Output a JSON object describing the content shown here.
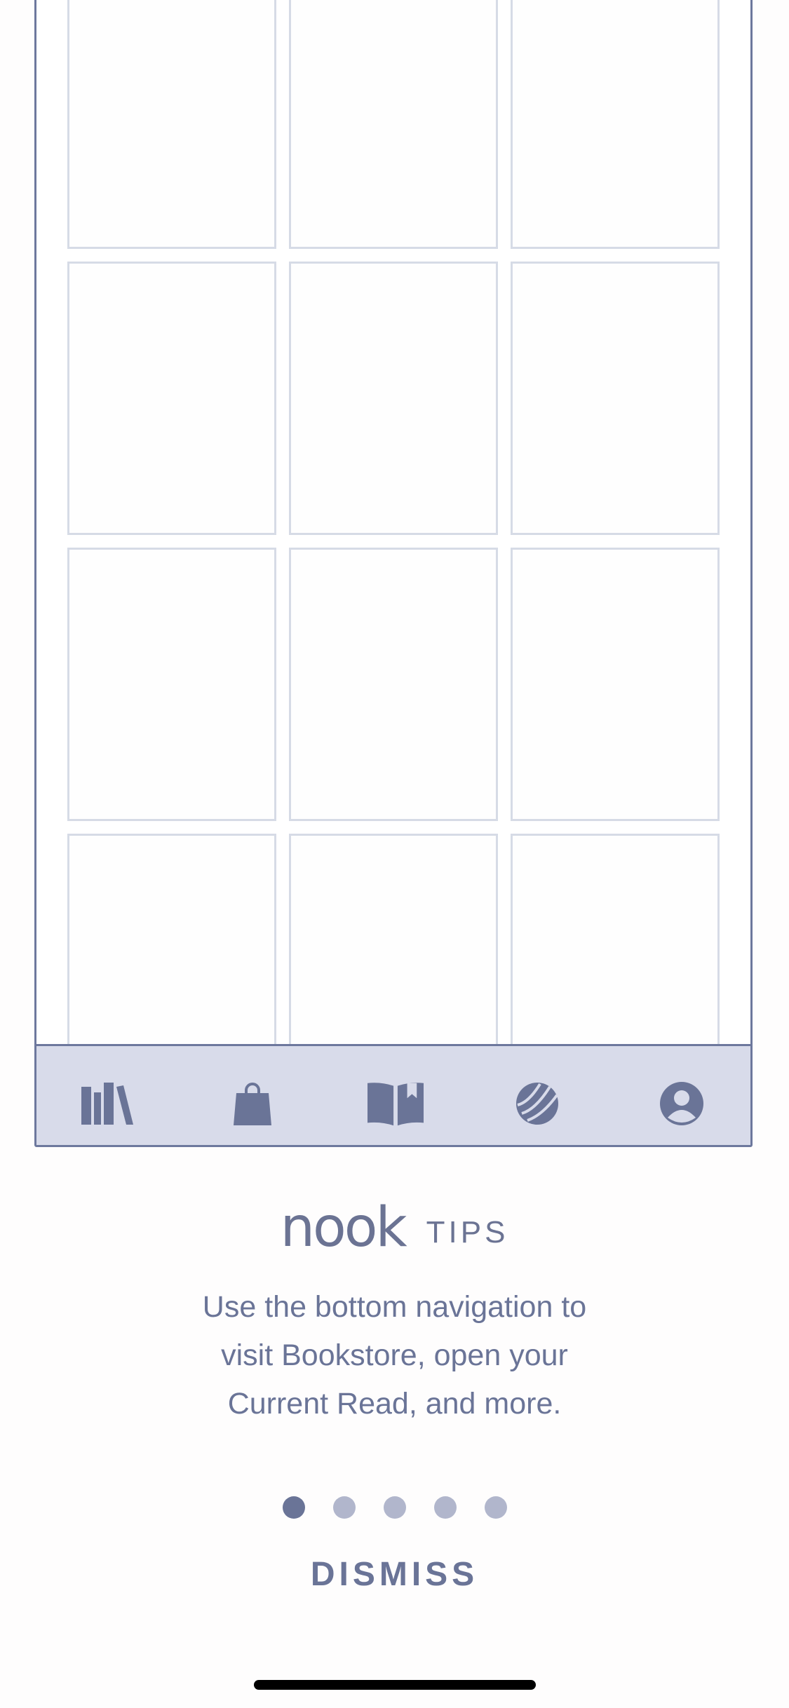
{
  "colors": {
    "frame": "#6d789d",
    "slot_border": "#d6dbe6",
    "nav_background": "#d8dbea",
    "nav_icon": "#6a7497",
    "text": "#6a7497",
    "dot_inactive": "#b1b6cc",
    "dot_active": "#6a7497"
  },
  "nav": {
    "items": [
      {
        "icon": "library-icon"
      },
      {
        "icon": "shopping-bag-icon"
      },
      {
        "icon": "open-book-icon"
      },
      {
        "icon": "discover-icon"
      },
      {
        "icon": "profile-icon"
      }
    ]
  },
  "tips": {
    "brand": "nook",
    "label": "TIPS",
    "text_line1": "Use the bottom navigation to",
    "text_line2": "visit Bookstore, open your",
    "text_line3": "Current Read, and more.",
    "page_count": 5,
    "active_page": 1,
    "dismiss_label": "DISMISS"
  }
}
